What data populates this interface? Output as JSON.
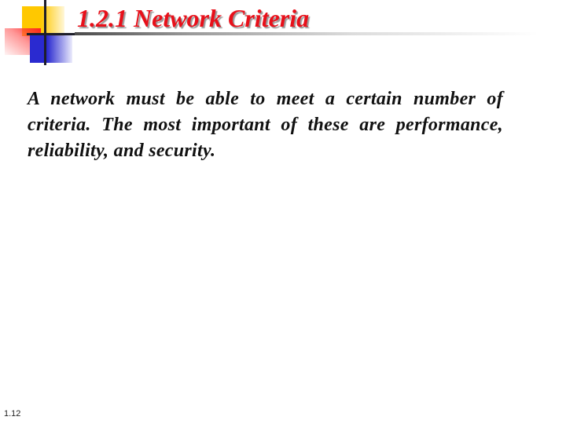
{
  "slide": {
    "title": "1.2.1 Network Criteria",
    "body": "A network must be able to meet a certain number of criteria. The most important of these are performance, reliability, and security.",
    "slide_number": "1.12"
  },
  "colors": {
    "title": "#e8101a",
    "logo_yellow": "#ffc800",
    "logo_red": "#ff2020",
    "logo_blue": "#2a2ad0",
    "logo_lines": "#1e1e2a"
  }
}
